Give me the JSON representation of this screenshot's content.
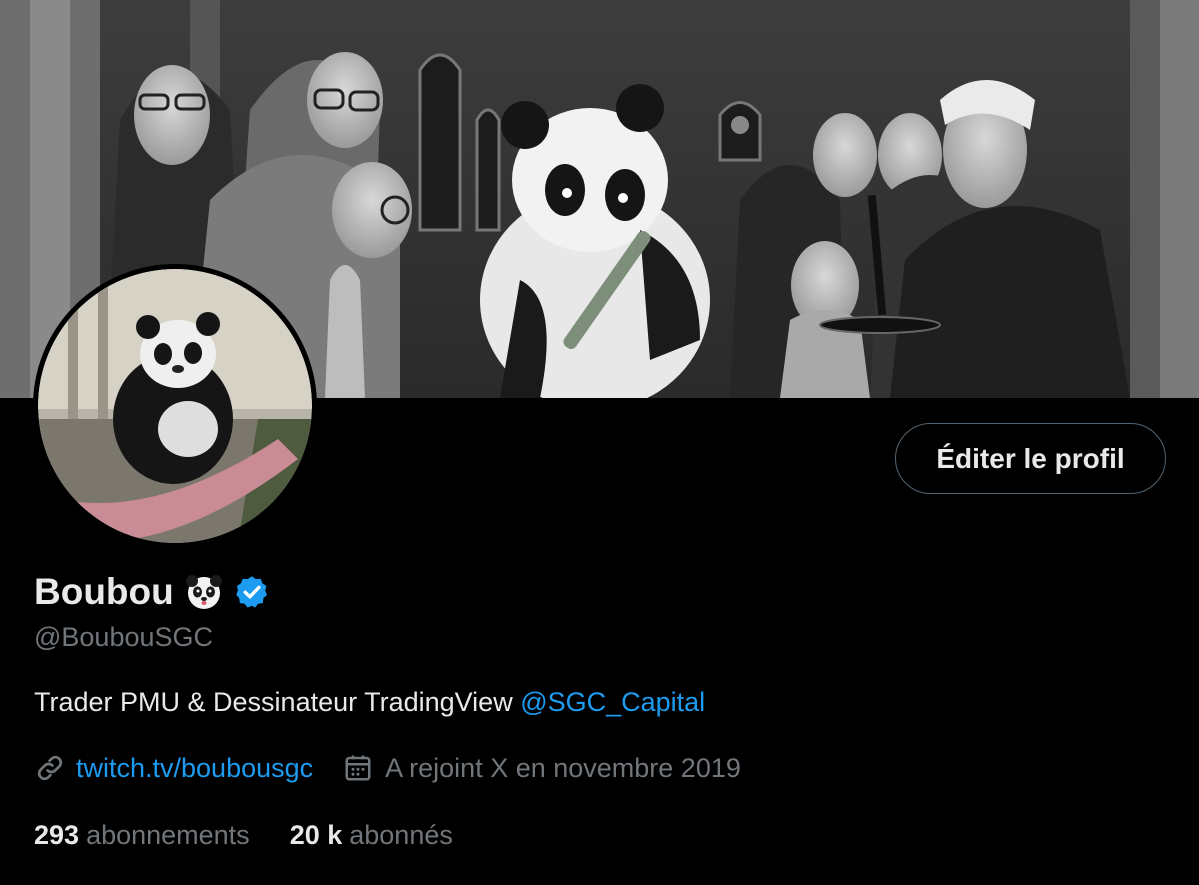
{
  "profile": {
    "display_name": "Boubou",
    "name_emoji": "panda-face-icon",
    "verified_icon": "verified-badge-icon",
    "handle": "@BoubouSGC",
    "edit_button_label": "Éditer le profil",
    "bio_text": "Trader PMU & Dessinateur TradingView ",
    "bio_mention": "@SGC_Capital",
    "website": "twitch.tv/boubousgc",
    "joined": "A rejoint X en novembre 2019",
    "following_count": "293",
    "following_label": "abonnements",
    "followers_count": "20 k",
    "followers_label": "abonnés"
  },
  "icons": {
    "link": "link-icon",
    "calendar": "calendar-icon"
  },
  "colors": {
    "background": "#000000",
    "text_primary": "#e7e9ea",
    "text_secondary": "#71767b",
    "accent": "#1d9bf0",
    "button_border": "#536471"
  }
}
